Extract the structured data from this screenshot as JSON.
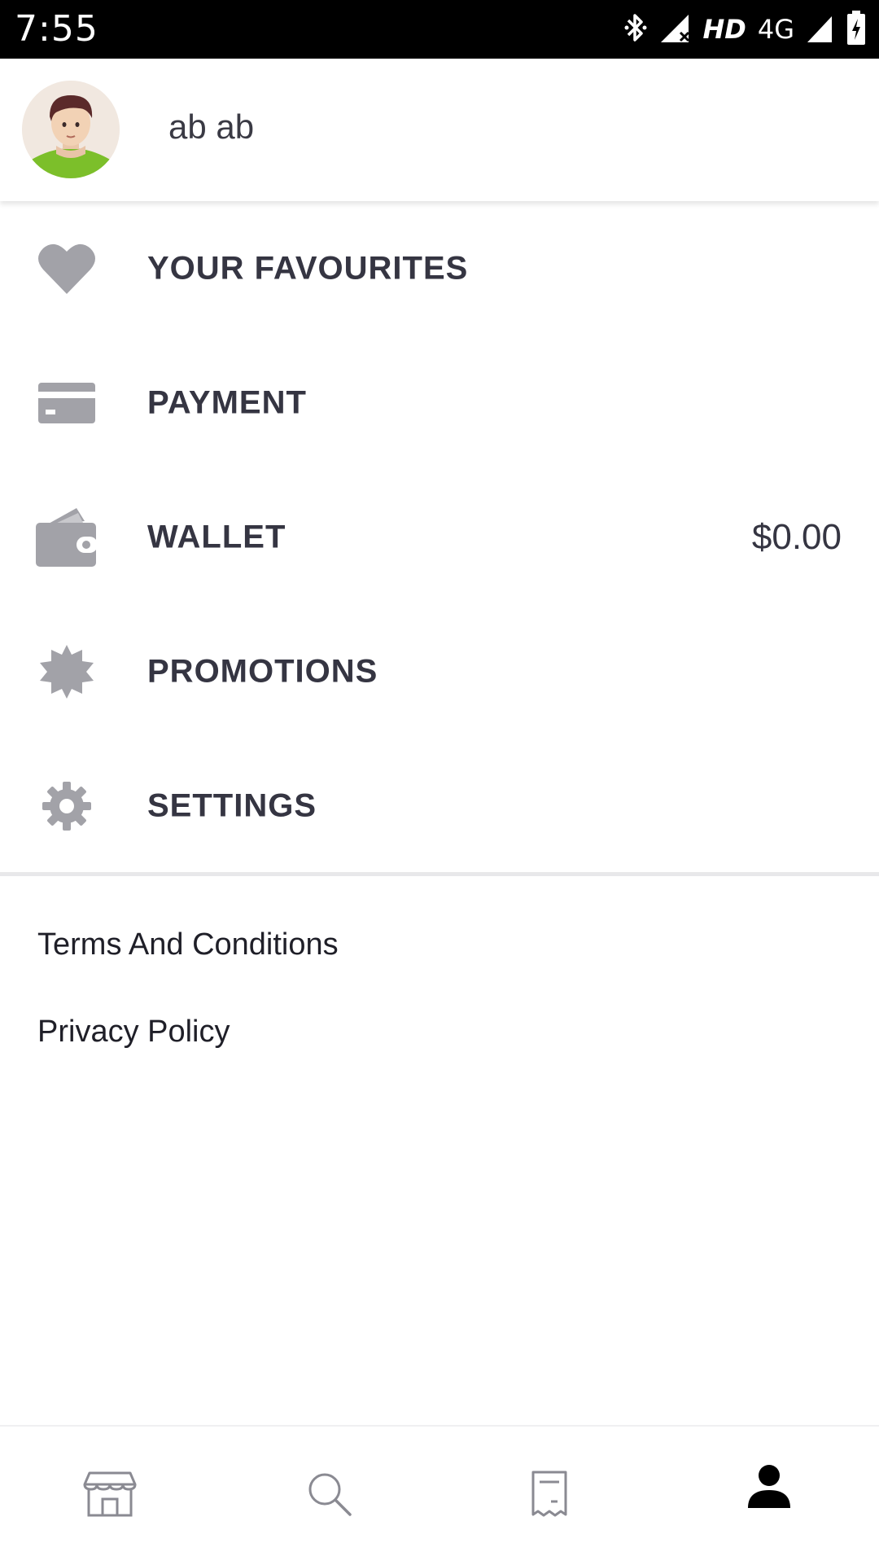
{
  "status_bar": {
    "time": "7:55",
    "hd_label": "HD",
    "network_label": "4G",
    "icons": [
      "bluetooth-icon",
      "signal-icon",
      "signal-icon",
      "battery-charging-icon"
    ]
  },
  "profile": {
    "name": "ab ab",
    "avatar_icon": "avatar-icon"
  },
  "menu": {
    "items": [
      {
        "label": "YOUR FAVOURITES",
        "icon": "heart-icon"
      },
      {
        "label": "PAYMENT",
        "icon": "credit-card-icon"
      },
      {
        "label": "WALLET",
        "icon": "wallet-icon",
        "value": "$0.00"
      },
      {
        "label": "PROMOTIONS",
        "icon": "badge-icon"
      },
      {
        "label": "SETTINGS",
        "icon": "gear-icon"
      }
    ]
  },
  "links": {
    "terms": "Terms And Conditions",
    "privacy": "Privacy Policy"
  },
  "bottom_nav": {
    "items": [
      {
        "icon": "store-icon",
        "active": false
      },
      {
        "icon": "search-icon",
        "active": false
      },
      {
        "icon": "receipt-icon",
        "active": false
      },
      {
        "icon": "account-icon",
        "active": true
      }
    ]
  },
  "colors": {
    "icon_gray": "#a2a2a8",
    "text_dark": "#353542",
    "status_bar": "#000000",
    "avatar_shirt": "#7cbf2a"
  }
}
